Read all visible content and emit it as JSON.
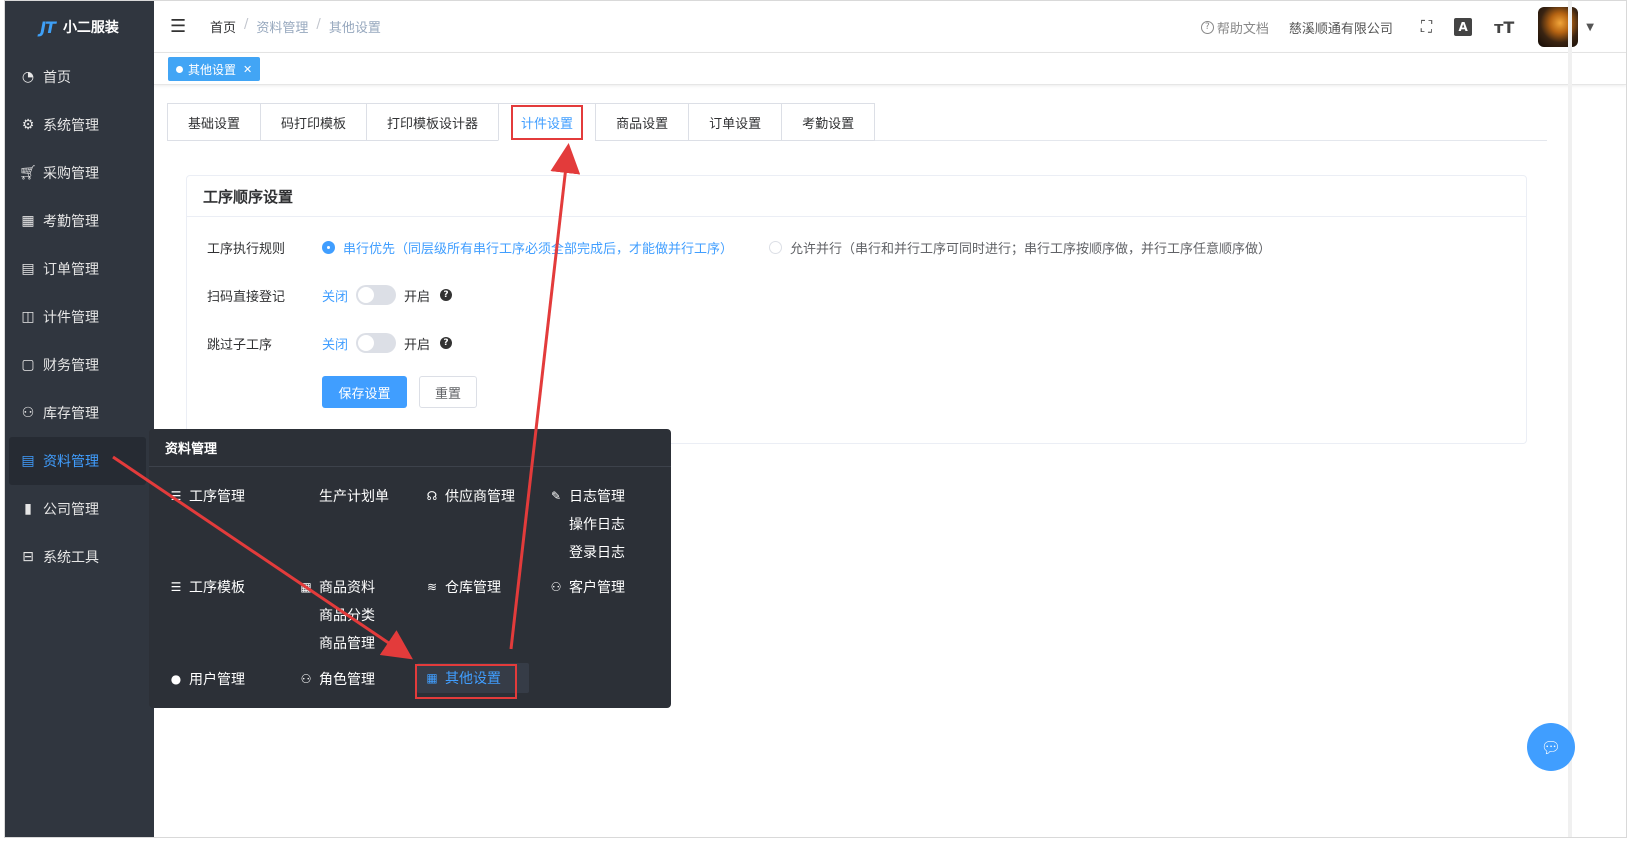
{
  "app": {
    "name": "小二服装",
    "logo_mark": "JT"
  },
  "sidebar": {
    "items": [
      {
        "label": "首页",
        "icon": "dashboard-icon"
      },
      {
        "label": "系统管理",
        "icon": "gear-icon"
      },
      {
        "label": "采购管理",
        "icon": "cart-icon"
      },
      {
        "label": "考勤管理",
        "icon": "grid-icon"
      },
      {
        "label": "订单管理",
        "icon": "clipboard-icon"
      },
      {
        "label": "计件管理",
        "icon": "book-icon"
      },
      {
        "label": "财务管理",
        "icon": "monitor-chart-icon"
      },
      {
        "label": "库存管理",
        "icon": "user-icon"
      },
      {
        "label": "资料管理",
        "icon": "document-icon",
        "active": true
      },
      {
        "label": "公司管理",
        "icon": "bar-chart-icon"
      },
      {
        "label": "系统工具",
        "icon": "toolbox-icon"
      }
    ]
  },
  "header": {
    "breadcrumb": [
      "首页",
      "资料管理",
      "其他设置"
    ],
    "help": "帮助文档",
    "company": "慈溪顺通有限公司"
  },
  "tagsview": {
    "tags": [
      {
        "label": "其他设置"
      }
    ]
  },
  "tabs": [
    "基础设置",
    "码打印模板",
    "打印模板设计器",
    "计件设置",
    "商品设置",
    "订单设置",
    "考勤设置"
  ],
  "active_tab": "计件设置",
  "card": {
    "title": "工序顺序设置",
    "rule_label": "工序执行规则",
    "radio_serial": "串行优先（同层级所有串行工序必须全部完成后，才能做并行工序）",
    "radio_parallel": "允许并行（串行和并行工序可同时进行；串行工序按顺序做，并行工序任意顺序做）",
    "scan_label": "扫码直接登记",
    "skip_label": "跳过子工序",
    "switch_off": "关闭",
    "switch_on": "开启",
    "save": "保存设置",
    "reset": "重置"
  },
  "megamenu": {
    "title": "资料管理",
    "groups": {
      "process_mgmt": "工序管理",
      "production_plan": "生产计划单",
      "supplier_mgmt": "供应商管理",
      "log_mgmt": "日志管理",
      "op_log": "操作日志",
      "login_log": "登录日志",
      "process_template": "工序模板",
      "product_info": "商品资料",
      "product_category": "商品分类",
      "product_mgmt": "商品管理",
      "warehouse_mgmt": "仓库管理",
      "customer_mgmt": "客户管理",
      "user_mgmt": "用户管理",
      "role_mgmt": "角色管理",
      "other_settings": "其他设置"
    }
  },
  "colors": {
    "sidebar_bg": "#30363f",
    "accent": "#409eff",
    "annotation": "#e33b3b"
  }
}
